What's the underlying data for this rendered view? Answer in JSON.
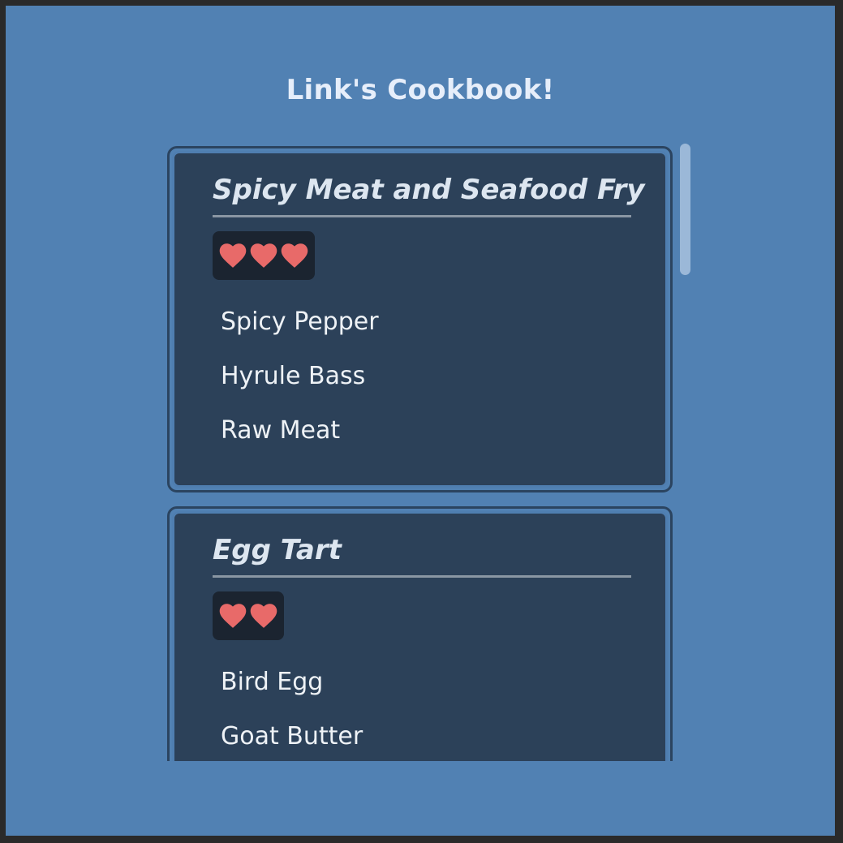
{
  "app": {
    "title": "Link's Cookbook!"
  },
  "recipes": [
    {
      "name": "Spicy Meat and Seafood Fry",
      "hearts": 3,
      "ingredients": [
        "Spicy Pepper",
        "Hyrule Bass",
        "Raw Meat"
      ]
    },
    {
      "name": "Egg Tart",
      "hearts": 2,
      "ingredients": [
        "Bird Egg",
        "Goat Butter"
      ]
    }
  ],
  "colors": {
    "background": "#5181b3",
    "card": "#2c4159",
    "heart": "#e86a69",
    "heart_badge": "#1b2430",
    "title_text": "#e6eefa"
  },
  "icons": {
    "heart": "heart-icon"
  }
}
